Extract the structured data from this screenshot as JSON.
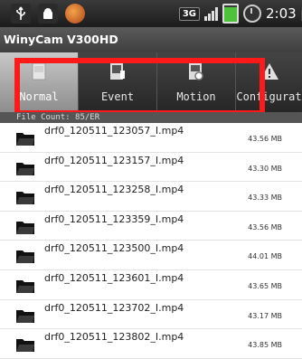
{
  "status_bar": {
    "time": "2:03 p",
    "network": "3G",
    "icons": [
      "usb-icon",
      "android-icon",
      "vlc-icon",
      "signal-icon",
      "battery-icon",
      "clock-icon"
    ]
  },
  "app": {
    "title": "WinyCam V300HD"
  },
  "tabs": [
    {
      "label": "Normal",
      "icon": "normal-file-icon",
      "selected": true
    },
    {
      "label": "Event",
      "icon": "event-file-icon",
      "selected": false
    },
    {
      "label": "Motion",
      "icon": "motion-file-icon",
      "selected": false
    },
    {
      "label": "Configurat",
      "icon": "warning-config-icon",
      "selected": false
    }
  ],
  "list_header": "File Count: 85/ER",
  "files": [
    {
      "name": "drf0_120511_123057_I.mp4",
      "size": "43.56 MB"
    },
    {
      "name": "drf0_120511_123157_I.mp4",
      "size": "43.30 MB"
    },
    {
      "name": "drf0_120511_123258_I.mp4",
      "size": "43.33 MB"
    },
    {
      "name": "drf0_120511_123359_I.mp4",
      "size": "43.56 MB"
    },
    {
      "name": "drf0_120511_123500_I.mp4",
      "size": "44.01 MB"
    },
    {
      "name": "drf0_120511_123601_I.mp4",
      "size": "43.65 MB"
    },
    {
      "name": "drf0_120511_123702_I.mp4",
      "size": "43.17 MB"
    },
    {
      "name": "drf0_120511_123802_I.mp4",
      "size": "43.85 MB"
    }
  ],
  "colors": {
    "highlight": "#ff1a1a",
    "tab_selected": "#b0b0b0",
    "tab_bg": "#2e2e2e"
  }
}
